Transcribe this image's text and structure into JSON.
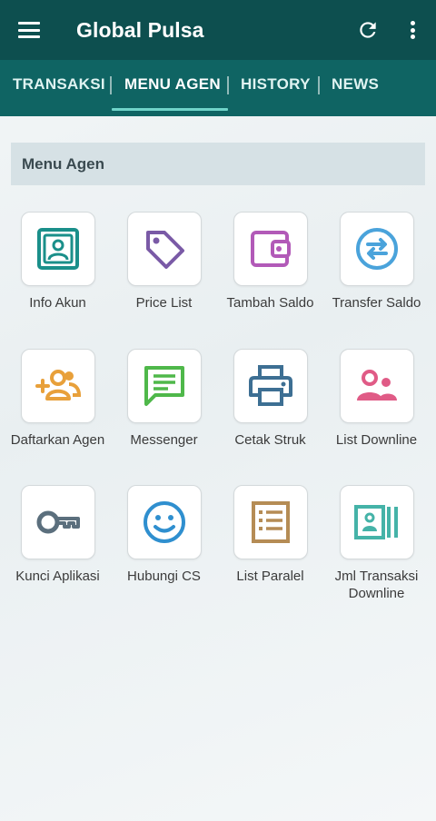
{
  "appbar": {
    "title": "Global Pulsa",
    "menu_icon": "hamburger-menu-icon",
    "refresh_icon": "refresh-icon",
    "more_icon": "more-vert-icon"
  },
  "tabs": [
    {
      "label": "TRANSAKSI",
      "active": false
    },
    {
      "label": "MENU AGEN",
      "active": true
    },
    {
      "label": "HISTORY",
      "active": false
    },
    {
      "label": "NEWS",
      "active": false
    }
  ],
  "section": {
    "title": "Menu Agen"
  },
  "menu": [
    {
      "label": "Info Akun",
      "icon": "id-card-icon",
      "color": "#1a8f8a"
    },
    {
      "label": "Price List",
      "icon": "price-tag-icon",
      "color": "#7a5aa6"
    },
    {
      "label": "Tambah Saldo",
      "icon": "wallet-icon",
      "color": "#b25ab8"
    },
    {
      "label": "Transfer Saldo",
      "icon": "transfer-arrows-icon",
      "color": "#4aa3db"
    },
    {
      "label": "Daftarkan Agen",
      "icon": "add-user-icon",
      "color": "#e8a03a"
    },
    {
      "label": "Messenger",
      "icon": "chat-message-icon",
      "color": "#4fb84a"
    },
    {
      "label": "Cetak Struk",
      "icon": "printer-icon",
      "color": "#3d6f93"
    },
    {
      "label": "List Downline",
      "icon": "users-group-icon",
      "color": "#e05b86"
    },
    {
      "label": "Kunci Aplikasi",
      "icon": "key-icon",
      "color": "#5b6f7d"
    },
    {
      "label": "Hubungi CS",
      "icon": "smiley-face-icon",
      "color": "#2f8fcf"
    },
    {
      "label": "List Paralel",
      "icon": "list-document-icon",
      "color": "#b58c55"
    },
    {
      "label": "Jml Transaksi Downline",
      "icon": "id-card-bars-icon",
      "color": "#45b3a8"
    }
  ]
}
